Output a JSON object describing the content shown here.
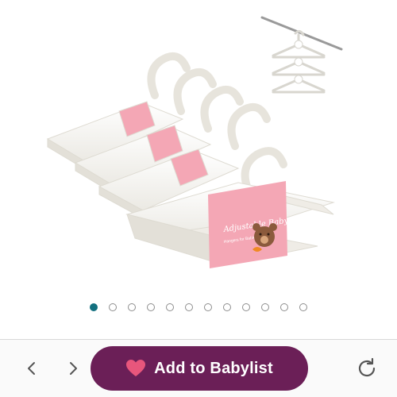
{
  "product": {
    "image_alt": "Adjustable baby hangers bundle",
    "package_title": "Adjustable Baby Hangers",
    "package_subtitle": "Hangers for Babies & Kids"
  },
  "carousel": {
    "total": 12,
    "active_index": 0
  },
  "toolbar": {
    "add_label": "Add to Babylist",
    "back_icon": "chevron-left-icon",
    "forward_icon": "chevron-right-icon",
    "reload_icon": "reload-icon",
    "heart_icon": "heart-icon"
  },
  "colors": {
    "accent": "#6b1f57",
    "heart": "#e8567c",
    "active_dot": "#13707f",
    "package_pink": "#f4a7b5"
  }
}
